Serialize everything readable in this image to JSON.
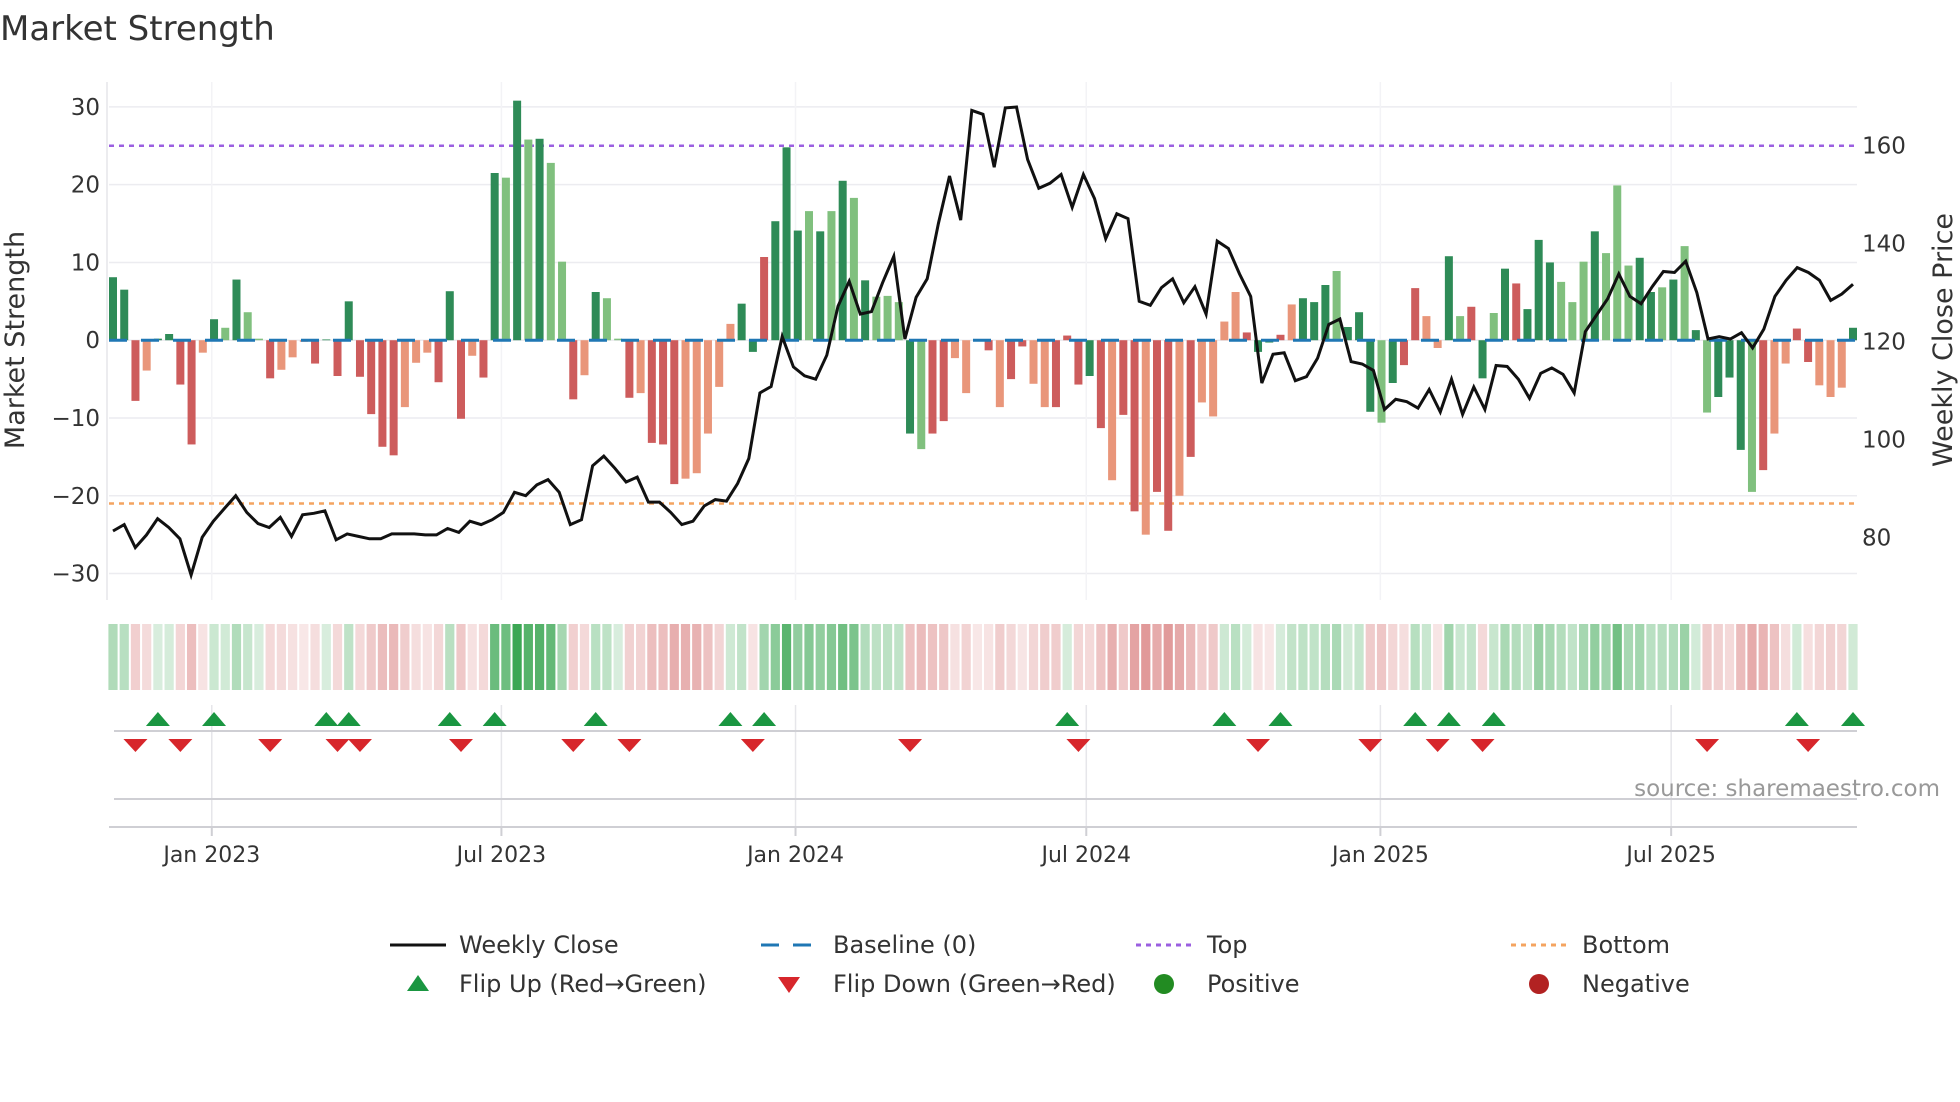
{
  "title": "Market Strength",
  "source": "source: sharemaestro.com",
  "colors": {
    "dark_green": "#2e8b57",
    "light_green": "#80c07e",
    "red": "#cd5c5c",
    "salmon": "#e9967a",
    "top": "#9b5fe0",
    "bottom": "#f4a460",
    "baseline": "#1f77b4",
    "close": "#111111",
    "flip_up": "#1a9641",
    "flip_down": "#d7262b",
    "positive": "#228b22",
    "negative": "#b22222"
  },
  "legend": [
    {
      "label": "Weekly Close",
      "icon": "solid-line"
    },
    {
      "label": "Baseline (0)",
      "icon": "dashed-line"
    },
    {
      "label": "Top",
      "icon": "dotted-line"
    },
    {
      "label": "Bottom",
      "icon": "dotted-line"
    },
    {
      "label": "Flip Up (Red→Green)",
      "icon": "triangle-up"
    },
    {
      "label": "Flip Down (Green→Red)",
      "icon": "triangle-down"
    },
    {
      "label": "Positive",
      "icon": "circle"
    },
    {
      "label": "Negative",
      "icon": "circle"
    }
  ],
  "chart_data": {
    "type": "bar",
    "title": "Market Strength",
    "ylabel": "Market Strength",
    "y2label": "Weekly Close Price",
    "ylim": [
      -33.4,
      33.2
    ],
    "y2lim": [
      67.2,
      173
    ],
    "yticks": [
      "30",
      "20",
      "10",
      "0",
      "−10",
      "−20",
      "−30"
    ],
    "ytick_values": [
      30,
      20,
      10,
      0,
      -10,
      -20,
      -30
    ],
    "y2ticks": [
      "160",
      "140",
      "120",
      "100",
      "80"
    ],
    "y2tick_values": [
      160,
      140,
      120,
      100,
      80
    ],
    "xticks": [
      "Jan 2023",
      "Jul 2023",
      "Jan 2024",
      "Jul 2024",
      "Jan 2025",
      "Jul 2025"
    ],
    "xtick_week_index": [
      8.8,
      34.6,
      60.8,
      86.7,
      112.9,
      138.8
    ],
    "top_level": 25,
    "bottom_level": -21,
    "baseline": 0,
    "x_unit": "week (Nov 2022 – Oct 2025)",
    "strength": [
      8.1,
      6.5,
      -7.8,
      -3.9,
      0.2,
      0.8,
      -5.7,
      -13.4,
      -1.6,
      2.7,
      1.6,
      7.8,
      3.6,
      0.2,
      -4.9,
      -3.8,
      -2.2,
      -0.2,
      -3.0,
      0.1,
      -4.6,
      5.0,
      -4.7,
      -9.5,
      -13.7,
      -14.8,
      -8.6,
      -2.9,
      -1.6,
      -5.4,
      6.3,
      -10.1,
      -2.0,
      -4.8,
      21.5,
      20.9,
      30.8,
      25.8,
      25.9,
      22.8,
      10.1,
      -7.6,
      -4.5,
      6.2,
      5.4,
      0.2,
      -7.4,
      -6.8,
      -13.2,
      -13.4,
      -18.5,
      -17.8,
      -17.1,
      -12.0,
      -6.0,
      2.1,
      4.7,
      -1.5,
      10.7,
      15.3,
      24.8,
      14.1,
      16.6,
      14.0,
      16.6,
      20.5,
      18.3,
      7.7,
      5.6,
      5.7,
      4.9,
      -12.0,
      -14.0,
      -12.0,
      -10.4,
      -2.3,
      -6.8,
      -0.1,
      -1.3,
      -8.6,
      -5.0,
      -0.8,
      -5.6,
      -8.6,
      -8.6,
      0.6,
      -5.7,
      -4.6,
      -11.3,
      -18.0,
      -9.6,
      -22.0,
      -25.0,
      -19.5,
      -24.5,
      -20.0,
      -15.0,
      -8.0,
      -9.8,
      2.4,
      6.2,
      1.0,
      -1.5,
      -0.3,
      0.7,
      4.6,
      5.4,
      4.9,
      7.1,
      8.9,
      1.7,
      3.6,
      -9.2,
      -10.6,
      -5.5,
      -3.2,
      6.7,
      3.1,
      -1.0,
      10.8,
      3.1,
      4.3,
      -4.9,
      3.5,
      9.2,
      7.3,
      4.0,
      12.9,
      10.0,
      7.5,
      4.9,
      10.1,
      14.0,
      11.2,
      19.9,
      9.6,
      10.6,
      6.2,
      6.8,
      7.8,
      12.1,
      1.3,
      -9.3,
      -7.3,
      -4.8,
      -14.1,
      -19.5,
      -16.7,
      -12.0,
      -3.0,
      1.5,
      -2.8,
      -5.8,
      -7.3,
      -6.1,
      1.6
    ],
    "shade": "ddrsddrrsdldllrsssrdrdrrrrsssrdrsrdldldllrsdllrsrrrsssssddrdddldldldllldlrrsssrsrrssrrrdrsrrsrrsrssssrddrsdddldddldrrssdlrdldrdddllldlllddldldldddlrssrrsssdrrrsd",
    "weekly_close": [
      81.3,
      82.6,
      77.9,
      80.5,
      83.8,
      82.0,
      79.7,
      72.3,
      80.0,
      83.3,
      85.9,
      88.5,
      85.1,
      82.8,
      82.0,
      84.1,
      80.2,
      84.6,
      84.9,
      85.4,
      79.5,
      80.7,
      80.2,
      79.7,
      79.7,
      80.7,
      80.7,
      80.7,
      80.5,
      80.5,
      81.8,
      81.0,
      83.3,
      82.6,
      83.6,
      85.1,
      89.2,
      88.5,
      90.7,
      91.8,
      89.2,
      82.6,
      83.6,
      94.6,
      96.6,
      94.1,
      91.3,
      92.3,
      87.2,
      87.2,
      85.1,
      82.6,
      83.3,
      86.4,
      87.7,
      87.4,
      91.0,
      96.1,
      109.5,
      110.8,
      121.0,
      114.8,
      113.0,
      112.3,
      117.2,
      127.2,
      132.3,
      125.6,
      126.1,
      132.0,
      137.4,
      120.5,
      129.0,
      132.8,
      144.1,
      153.8,
      144.8,
      167.2,
      166.4,
      155.6,
      167.7,
      167.9,
      157.2,
      151.3,
      152.3,
      154.1,
      147.4,
      154.1,
      149.2,
      141.0,
      146.1,
      145.1,
      128.2,
      127.4,
      131.0,
      132.8,
      127.9,
      131.2,
      125.6,
      140.5,
      139.0,
      133.8,
      129.2,
      111.5,
      117.4,
      117.7,
      112.0,
      112.8,
      116.6,
      123.5,
      124.6,
      115.9,
      115.4,
      114.1,
      106.1,
      108.2,
      107.7,
      106.4,
      110.2,
      105.6,
      112.3,
      105.1,
      110.7,
      106.1,
      115.1,
      114.9,
      112.3,
      108.4,
      113.5,
      114.6,
      113.3,
      109.5,
      122.0,
      125.4,
      128.7,
      133.8,
      129.2,
      127.7,
      131.2,
      134.3,
      134.1,
      136.4,
      130.0,
      120.5,
      121.0,
      120.5,
      121.8,
      118.7,
      122.5,
      129.2,
      132.5,
      135.1,
      134.1,
      132.5,
      128.4,
      129.7,
      131.7
    ]
  }
}
